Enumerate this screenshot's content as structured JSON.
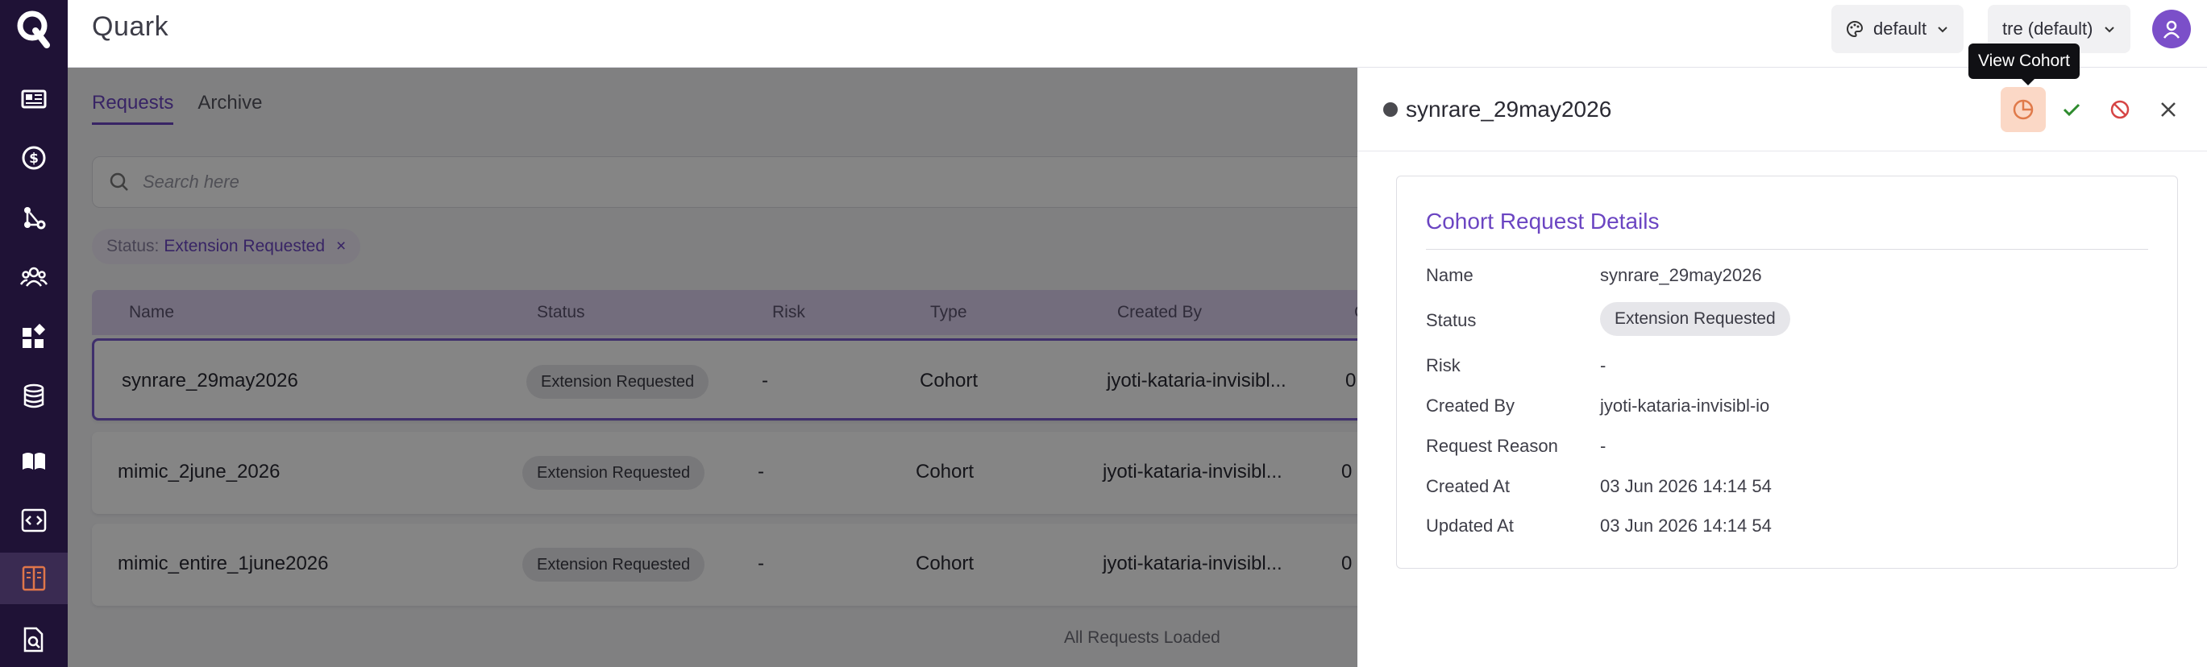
{
  "app": {
    "title": "Quark",
    "logo_letter": "Q"
  },
  "header": {
    "theme_select": {
      "value": "default",
      "icon": "palette-icon"
    },
    "tre_select": {
      "value": "tre (default)"
    },
    "avatar_icon": "user-icon"
  },
  "sidebar": {
    "items": [
      {
        "name": "dashboard",
        "icon": "news-icon"
      },
      {
        "name": "billing",
        "icon": "dollar-icon"
      },
      {
        "name": "pipelines",
        "icon": "workflow-icon"
      },
      {
        "name": "users",
        "icon": "users-icon"
      },
      {
        "name": "apps",
        "icon": "widgets-icon"
      },
      {
        "name": "databases",
        "icon": "database-icon"
      },
      {
        "name": "studies",
        "icon": "book-icon"
      },
      {
        "name": "code",
        "icon": "code-icon"
      },
      {
        "name": "requests",
        "icon": "request-list-icon",
        "active": true
      },
      {
        "name": "review",
        "icon": "file-search-icon"
      }
    ]
  },
  "main": {
    "tabs": [
      {
        "label": "Requests",
        "active": true
      },
      {
        "label": "Archive",
        "active": false
      }
    ],
    "search": {
      "placeholder": "Search here"
    },
    "filter": {
      "key": "Status:",
      "value": "Extension Requested",
      "remove": "×"
    },
    "table": {
      "columns": [
        "Name",
        "Status",
        "Risk",
        "Type",
        "Created By",
        "C"
      ],
      "rows": [
        {
          "name": "synrare_29may2026",
          "status": "Extension Requested",
          "risk": "-",
          "type": "Cohort",
          "created_by": "jyoti-kataria-invisibl...",
          "extra": "0",
          "selected": true
        },
        {
          "name": "mimic_2june_2026",
          "status": "Extension Requested",
          "risk": "-",
          "type": "Cohort",
          "created_by": "jyoti-kataria-invisibl...",
          "extra": "0",
          "selected": false
        },
        {
          "name": "mimic_entire_1june2026",
          "status": "Extension Requested",
          "risk": "-",
          "type": "Cohort",
          "created_by": "jyoti-kataria-invisibl...",
          "extra": "0",
          "selected": false
        }
      ],
      "footer": "All Requests Loaded"
    }
  },
  "drawer": {
    "title": "synrare_29may2026",
    "actions": [
      {
        "name": "view-cohort",
        "icon": "pie-chart-icon",
        "tooltip": "View Cohort",
        "color": "#e07a4a"
      },
      {
        "name": "approve",
        "icon": "check-icon",
        "color": "#2e8b2e"
      },
      {
        "name": "reject",
        "icon": "block-icon",
        "color": "#d64545"
      },
      {
        "name": "close",
        "icon": "close-icon",
        "color": "#444444"
      }
    ],
    "card": {
      "title": "Cohort Request Details",
      "fields": [
        {
          "label": "Name",
          "value": "synrare_29may2026"
        },
        {
          "label": "Status",
          "value": "Extension Requested",
          "badge": true
        },
        {
          "label": "Risk",
          "value": "-"
        },
        {
          "label": "Created By",
          "value": "jyoti-kataria-invisibl-io"
        },
        {
          "label": "Request Reason",
          "value": "-"
        },
        {
          "label": "Created At",
          "value": "03 Jun 2026 14:14 54"
        },
        {
          "label": "Updated At",
          "value": "03 Jun 2026 14:14 54"
        }
      ]
    }
  },
  "colors": {
    "accent": "#6b45c2",
    "sidebar_bg": "#1f1236",
    "active_icon": "#e0764a"
  }
}
